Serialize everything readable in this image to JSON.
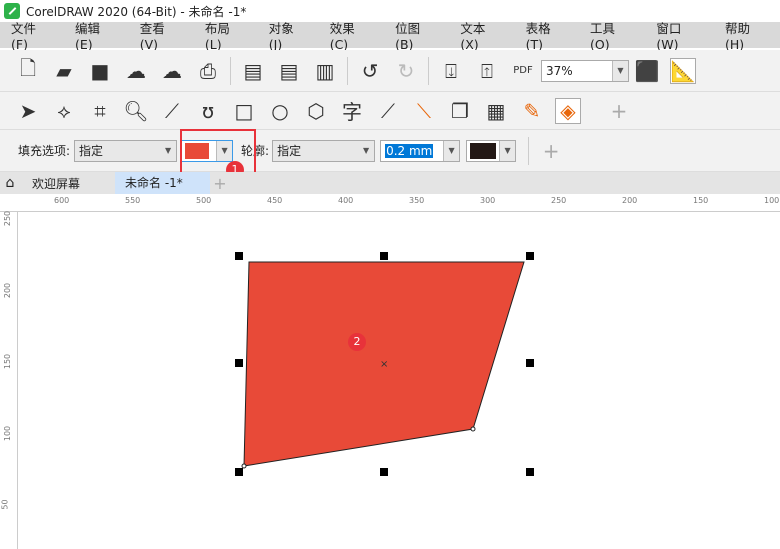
{
  "title": "CorelDRAW 2020 (64-Bit) - 未命名 -1*",
  "menu": [
    "文件(F)",
    "编辑(E)",
    "查看(V)",
    "布局(L)",
    "对象(J)",
    "效果(C)",
    "位图(B)",
    "文本(X)",
    "表格(T)",
    "工具(O)",
    "窗口(W)",
    "帮助(H)"
  ],
  "toolbar": {
    "zoom": "37%",
    "pdf": "PDF"
  },
  "property_bar": {
    "fill_label": "填充选项:",
    "fill_value": "指定",
    "fill_color": "#e84a38",
    "outline_label": "轮廓:",
    "outline_value": "指定",
    "outline_width": "0.2 mm",
    "outline_color": "#231815"
  },
  "tabs": {
    "welcome": "欢迎屏幕",
    "doc": "未命名 -1*"
  },
  "ruler": {
    "h": [
      "600",
      "550",
      "500",
      "450",
      "400",
      "350",
      "300",
      "250",
      "200",
      "150",
      "100"
    ],
    "v": [
      "250",
      "200",
      "150",
      "100",
      "50"
    ]
  },
  "annotations": {
    "a1": "1",
    "a2": "2"
  },
  "colors": {
    "highlight": "#e8323a",
    "shape_fill": "#e84a38"
  }
}
